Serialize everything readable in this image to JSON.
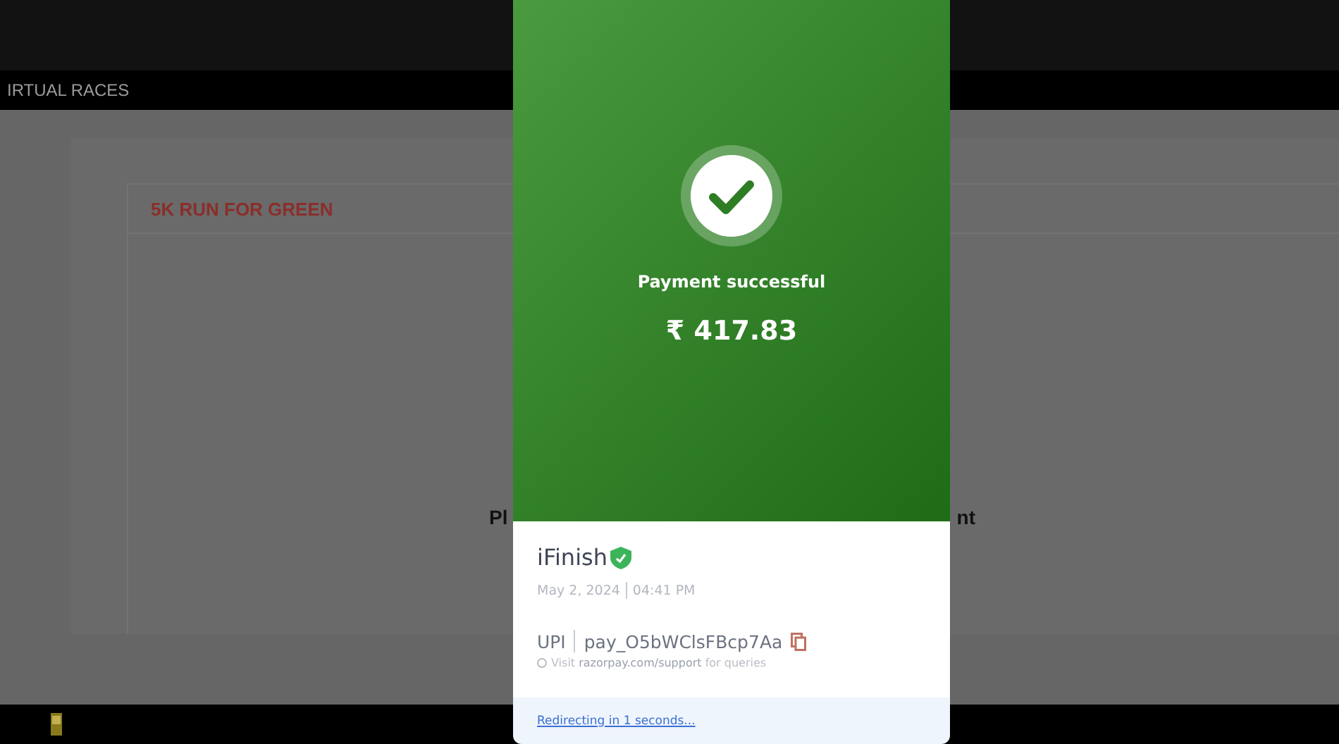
{
  "page": {
    "nav_label": "IRTUAL RACES",
    "race_title": "5K RUN FOR GREEN",
    "message_left": "Pl",
    "message_right": "nt"
  },
  "dialog": {
    "status": "Payment successful",
    "amount": "₹ 417.83",
    "merchant": "iFinish",
    "merchant_verified": true,
    "date": "May 2, 2024",
    "time": "04:41 PM",
    "method": "UPI",
    "payment_id": "pay_O5bWClsFBcp7Aa",
    "support_prefix": "Visit",
    "support_link": "razorpay.com/support",
    "support_suffix": "for queries",
    "redirect": "Redirecting in 1 seconds..."
  }
}
